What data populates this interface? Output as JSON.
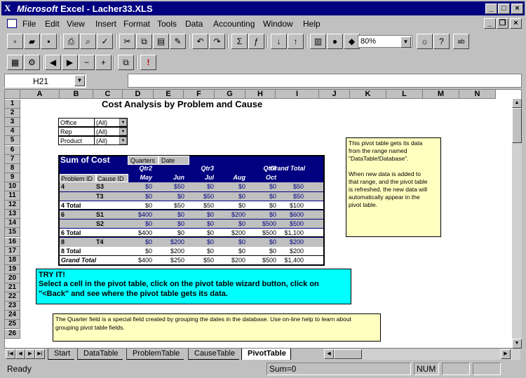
{
  "window": {
    "title_brand": "Microsoft",
    "title_rest": " Excel - Lacher33.XLS",
    "minimize": "_",
    "maximize": "□",
    "close": "×",
    "doc_min": "_",
    "doc_restore": "❐",
    "doc_close": "×"
  },
  "menu": [
    "File",
    "Edit",
    "View",
    "Insert",
    "Format",
    "Tools",
    "Data",
    "Accounting",
    "Window",
    "Help"
  ],
  "toolbar": {
    "zoom": "80%"
  },
  "namebox": "H21",
  "columns": [
    "A",
    "B",
    "C",
    "D",
    "E",
    "F",
    "G",
    "H",
    "I",
    "J",
    "K",
    "L",
    "M",
    "N"
  ],
  "rows": [
    "1",
    "2",
    "3",
    "4",
    "5",
    "6",
    "7",
    "8",
    "9",
    "10",
    "11",
    "12",
    "13",
    "14",
    "15",
    "16",
    "17",
    "18",
    "19",
    "20",
    "21",
    "22",
    "23",
    "24",
    "25",
    "26"
  ],
  "sheet": {
    "title": "Cost Analysis by Problem and Cause",
    "filters": [
      {
        "label": "Office",
        "value": "(All)"
      },
      {
        "label": "Rep",
        "value": "(All)"
      },
      {
        "label": "Product",
        "value": "(All)"
      }
    ],
    "pivot": {
      "data_label": "Sum of Cost",
      "col_fields": [
        "Quarters",
        "Date"
      ],
      "quarters": [
        "Qtr2",
        "Qtr3",
        "Qtr4"
      ],
      "grand_total_label": "Grand Total",
      "months": [
        "May",
        "Jun",
        "Jul",
        "Aug",
        "Oct"
      ],
      "row_fields": [
        "Problem ID",
        "Cause ID"
      ],
      "rows": [
        {
          "p": "4",
          "c": "S3",
          "v": [
            "$0",
            "$50",
            "$0",
            "$0",
            "$0",
            "$50"
          ],
          "type": "data"
        },
        {
          "p": "",
          "c": "T3",
          "v": [
            "$0",
            "$0",
            "$50",
            "$0",
            "$0",
            "$50"
          ],
          "type": "data"
        },
        {
          "p": "4 Total",
          "c": "",
          "v": [
            "$0",
            "$50",
            "$50",
            "$0",
            "$0",
            "$100"
          ],
          "type": "total"
        },
        {
          "p": "6",
          "c": "S1",
          "v": [
            "$400",
            "$0",
            "$0",
            "$200",
            "$0",
            "$600"
          ],
          "type": "data"
        },
        {
          "p": "",
          "c": "S2",
          "v": [
            "$0",
            "$0",
            "$0",
            "$0",
            "$500",
            "$500"
          ],
          "type": "data"
        },
        {
          "p": "6 Total",
          "c": "",
          "v": [
            "$400",
            "$0",
            "$0",
            "$200",
            "$500",
            "$1,100"
          ],
          "type": "total"
        },
        {
          "p": "8",
          "c": "T4",
          "v": [
            "$0",
            "$200",
            "$0",
            "$0",
            "$0",
            "$200"
          ],
          "type": "data"
        },
        {
          "p": "8 Total",
          "c": "",
          "v": [
            "$0",
            "$200",
            "$0",
            "$0",
            "$0",
            "$200"
          ],
          "type": "total"
        },
        {
          "p": "Grand Total",
          "c": "",
          "v": [
            "$400",
            "$250",
            "$50",
            "$200",
            "$500",
            "$1,400"
          ],
          "type": "grand"
        }
      ]
    },
    "note1": [
      "This pivot table gets its data",
      "from the range named",
      "\"DataTable!Database\".",
      "",
      "When new data is added to",
      "that range, and the pivot table",
      "is refreshed, the new data will",
      "automatically appear in the",
      "pivot table."
    ],
    "tryit": [
      "TRY IT!",
      "Select a cell in the pivot table, click on the pivot table wizard button, click on",
      "\"<Back\" and see where the pivot table gets its data."
    ],
    "note2": [
      "The Quarter field is a special field created by grouping the dates in the database.  Use on-line help to learn about",
      "grouping pivot table fields."
    ]
  },
  "tabs": [
    "Start",
    "DataTable",
    "ProblemTable",
    "CauseTable",
    "PivotTable"
  ],
  "active_tab": "PivotTable",
  "status": {
    "ready": "Ready",
    "sum": "Sum=0",
    "num": "NUM"
  }
}
